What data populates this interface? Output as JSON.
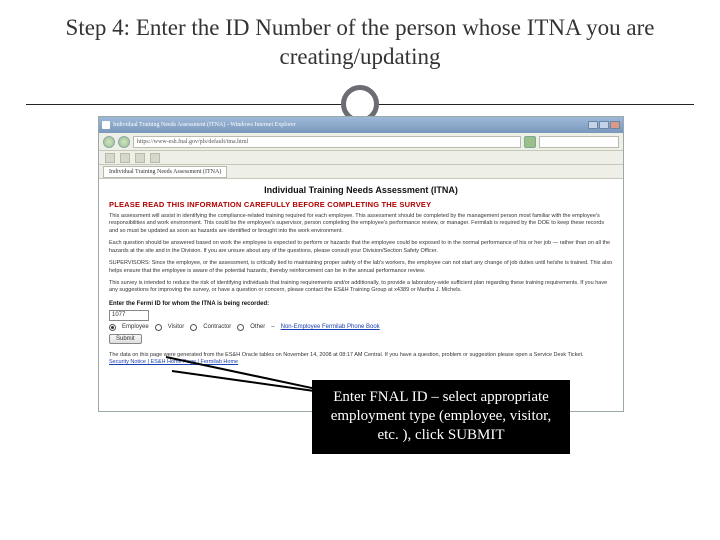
{
  "title": "Step 4:  Enter the ID Number of the person whose ITNA you are creating/updating",
  "browser": {
    "window_title": "Individual Training Needs Assessment (ITNA) - Windows Internet Explorer",
    "url": "https://www-esh.fnal.gov/pls/default/itna.html",
    "tab_label": "Individual Training Needs Assessment (ITNA)"
  },
  "page": {
    "heading": "Individual Training Needs Assessment (ITNA)",
    "red_banner": "PLEASE READ THIS INFORMATION CAREFULLY BEFORE COMPLETING THE SURVEY",
    "para1": "This assessment will assist in identifying the compliance-related training required for each employee. This assessment should be completed by the management person most familiar with the employee's responsibilities and work environment. This could be the employee's supervisor, person completing the employee's performance review, or manager. Fermilab is required by the DOE to keep these records and so must be updated as soon as hazards are identified or brought into the work environment.",
    "para2": "Each question should be answered based on work the employee is expected to perform or hazards that the employee could be exposed to in the normal performance of his or her job — rather than on all the hazards at the site and in the Division. If you are unsure about any of the questions, please consult your Division/Section Safety Officer.",
    "para3": "SUPERVISORS: Since the employee, or the assessment, is critically tied to maintaining proper safety of the lab's workers, the employee can not start any change of job duties until he/she is trained. This also helps ensure that the employee is aware of the potential hazards, thereby reinforcement can be in the annual performance review.",
    "para4": "This survey is intended to reduce the risk of identifying individuals that training requirements and/or additionally, to provide a laboratory-wide sufficient plan regarding these training requirements. If you have any suggestions for improving the survey, or have a question or concern, please contact the ES&H Training Group at x4389 or Martha J. Michels.",
    "contact_link": "Martha J. Michels",
    "prompt": "Enter the Fermi ID for whom the ITNA is being recorded:",
    "id_value": "1077",
    "radios": {
      "employee": "Employee",
      "visitor": "Visitor",
      "contractor": "Contractor",
      "other": "Other"
    },
    "other_links": "Non-Employee Fermilab Phone Book",
    "submit": "Submit",
    "footer": "The data on this page were generated from the ES&H Oracle tables on November 14, 2008 at 08:17 AM Central. If you have a question, problem or suggestion please open a Service Desk Ticket.",
    "footer_links": "Security Notice | ES&H Home Page | Fermilab Home"
  },
  "callout": "Enter FNAL ID – select appropriate employment type (employee, visitor, etc. ), click SUBMIT"
}
